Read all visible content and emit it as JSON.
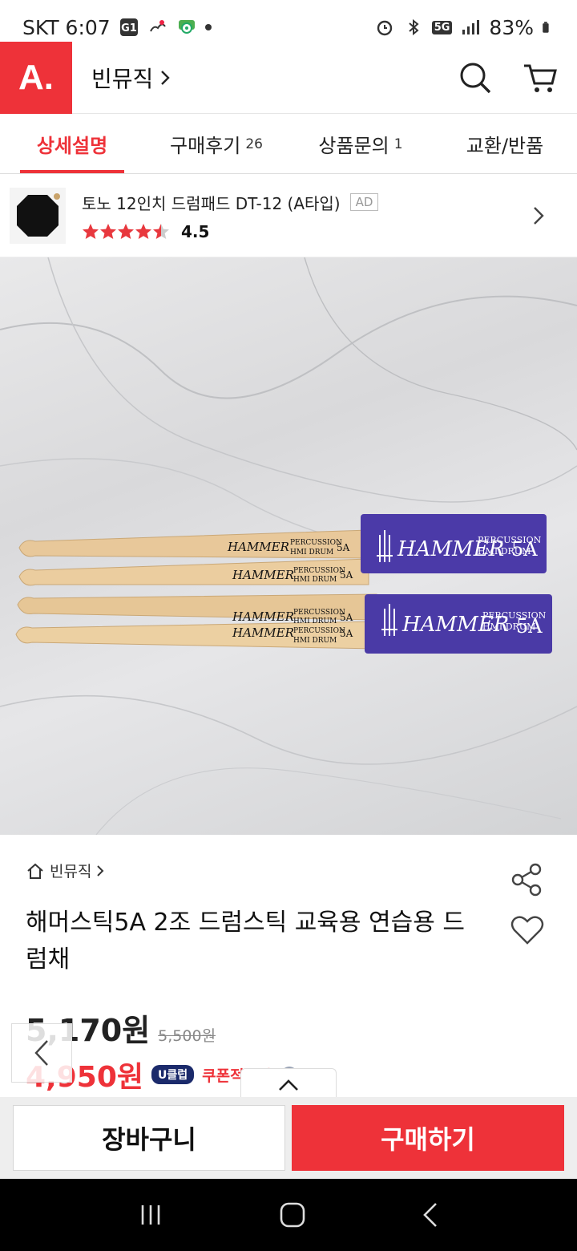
{
  "status_bar": {
    "carrier_time": "SKT 6:07",
    "network": "5G",
    "battery": "83%",
    "icons": [
      "g1-icon",
      "weather-icon",
      "maps-icon",
      "notification-dot",
      "alarm-icon",
      "bluetooth-icon",
      "network-5g-icon",
      "signal-icon",
      "battery-icon"
    ]
  },
  "header": {
    "logo_text": "A.",
    "store_name": "빈뮤직",
    "icons": [
      "search-icon",
      "cart-icon"
    ]
  },
  "tabs": [
    {
      "label": "상세설명",
      "count": "",
      "active": true
    },
    {
      "label": "구매후기",
      "count": "26",
      "active": false
    },
    {
      "label": "상품문의",
      "count": "1",
      "active": false
    },
    {
      "label": "교환/반품",
      "count": "",
      "active": false
    }
  ],
  "ad": {
    "title": "토노 12인치 드럼패드 DT-12 (A타입)",
    "badge": "AD",
    "rating": "4.5",
    "rating_value": 4.5,
    "rating_max": 5
  },
  "product_image": {
    "sleeve_brand": "HAMMER",
    "sleeve_sub_1": "PERCUSSION",
    "sleeve_sub_2": "HMI DRUM",
    "sleeve_size": "5A"
  },
  "product": {
    "breadcrumb": "빈뮤직",
    "title": "해머스틱5A 2조 드럼스틱 교육용 연습용 드럼채",
    "price": "5,170원",
    "original_price": "5,500원",
    "coupon_price": "4,950원",
    "uclub_label": "U클럽",
    "coupon_label": "쿠폰적용가"
  },
  "bottom_bar": {
    "cart_label": "장바구니",
    "buy_label": "구매하기"
  },
  "colors": {
    "brand_red": "#ee3239",
    "sleeve_purple": "#4b3aa8",
    "wood": "#e8c89a"
  }
}
